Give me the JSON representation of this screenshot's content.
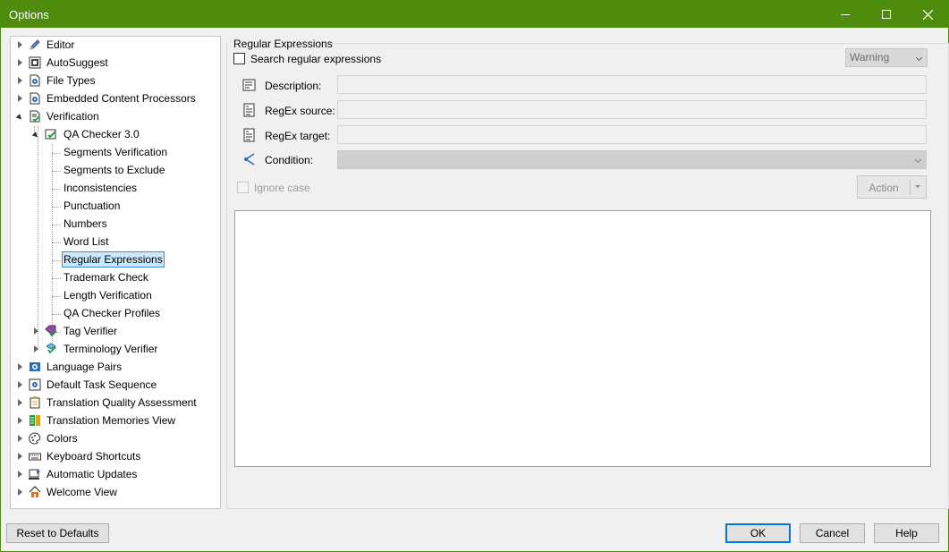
{
  "window": {
    "title": "Options",
    "controls": {
      "minimize": "minimize-icon",
      "maximize": "maximize-icon",
      "close": "close-icon"
    }
  },
  "tree": {
    "items": [
      {
        "label": "Editor",
        "icon": "pencil-icon"
      },
      {
        "label": "AutoSuggest",
        "icon": "autosuggest-icon"
      },
      {
        "label": "File Types",
        "icon": "file-gear-icon"
      },
      {
        "label": "Embedded Content Processors",
        "icon": "file-gear-icon"
      },
      {
        "label": "Verification",
        "icon": "verification-icon"
      },
      {
        "label": "QA Checker 3.0",
        "icon": "qa-checker-icon"
      },
      {
        "label": "Segments Verification"
      },
      {
        "label": "Segments to Exclude"
      },
      {
        "label": "Inconsistencies"
      },
      {
        "label": "Punctuation"
      },
      {
        "label": "Numbers"
      },
      {
        "label": "Word List"
      },
      {
        "label": "Regular Expressions",
        "selected": true
      },
      {
        "label": "Trademark Check"
      },
      {
        "label": "Length Verification"
      },
      {
        "label": "QA Checker Profiles"
      },
      {
        "label": "Tag Verifier",
        "icon": "tag-verifier-icon"
      },
      {
        "label": "Terminology Verifier",
        "icon": "terminology-verifier-icon"
      },
      {
        "label": "Language Pairs",
        "icon": "language-pairs-icon"
      },
      {
        "label": "Default Task Sequence",
        "icon": "task-sequence-icon"
      },
      {
        "label": "Translation Quality Assessment",
        "icon": "quality-assessment-icon"
      },
      {
        "label": "Translation Memories View",
        "icon": "tm-view-icon"
      },
      {
        "label": "Colors",
        "icon": "palette-icon"
      },
      {
        "label": "Keyboard Shortcuts",
        "icon": "keyboard-icon"
      },
      {
        "label": "Automatic Updates",
        "icon": "updates-icon"
      },
      {
        "label": "Welcome View",
        "icon": "home-icon"
      }
    ]
  },
  "panel": {
    "group_title": "Regular Expressions",
    "search_checkbox_label": "Search regular expressions",
    "search_checked": false,
    "severity_value": "Warning",
    "description_label": "Description:",
    "description_value": "",
    "regex_source_label": "RegEx source:",
    "regex_source_value": "",
    "regex_target_label": "RegEx target:",
    "regex_target_value": "",
    "condition_label": "Condition:",
    "condition_value": "",
    "ignore_case_label": "Ignore case",
    "ignore_case_checked": false,
    "action_button_label": "Action"
  },
  "footer": {
    "reset_label": "Reset to Defaults",
    "ok_label": "OK",
    "cancel_label": "Cancel",
    "help_label": "Help"
  },
  "colors": {
    "titlebar": "#4f8b0c",
    "selection_bg": "#cce8ff",
    "selection_border": "#3c8fd8",
    "default_button_border": "#0078d7"
  }
}
